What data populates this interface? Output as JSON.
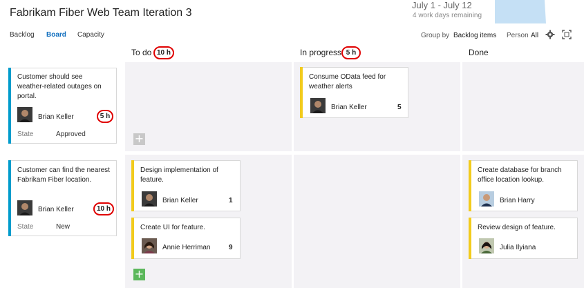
{
  "header": {
    "title": "Fabrikam Fiber Web Team Iteration 3",
    "iteration_dates": "July 1 - July 12",
    "days_remaining": "4 work days remaining"
  },
  "nav": {
    "backlog": "Backlog",
    "board": "Board",
    "capacity": "Capacity"
  },
  "toolbar": {
    "group_by_label": "Group by",
    "group_by_value": "Backlog items",
    "person_label": "Person",
    "person_value": "All",
    "settings_icon": "gear-icon",
    "fullscreen_icon": "fullscreen-icon"
  },
  "columns": [
    {
      "name": "To do",
      "hours": "10 h"
    },
    {
      "name": "In progress",
      "hours": "5 h"
    },
    {
      "name": "Done"
    }
  ],
  "backlog_items": [
    {
      "title_lines": [
        "Customer should see",
        "weather-related outages on",
        "portal."
      ],
      "assignee": "Brian Keller",
      "remaining": "5 h",
      "state_label": "State",
      "state": "Approved"
    },
    {
      "title_lines": [
        "Customer can find the nearest",
        "Fabrikam Fiber location."
      ],
      "assignee": "Brian Keller",
      "remaining": "10 h",
      "state_label": "State",
      "state": "New"
    }
  ],
  "tasks": {
    "row1_inprogress": {
      "title_lines": [
        "Consume OData feed for",
        "weather alerts"
      ],
      "assignee": "Brian Keller",
      "remaining": "5"
    },
    "row2_todo_1": {
      "title_lines": [
        "Design implementation of",
        "feature."
      ],
      "assignee": "Brian Keller",
      "remaining": "1"
    },
    "row2_todo_2": {
      "title_lines": [
        "Create UI for feature."
      ],
      "assignee": "Annie Herriman",
      "remaining": "9"
    },
    "row2_done_1": {
      "title_lines": [
        "Create database for branch",
        "office location lookup."
      ],
      "assignee": "Brian Harry"
    },
    "row2_done_2": {
      "title_lines": [
        "Review design of feature."
      ],
      "assignee": "Julia Ilyiana"
    }
  },
  "add_icon": "+",
  "colors": {
    "accent": "#106ebe",
    "backlog_bar": "#009ccc",
    "task_bar": "#f2cb1d",
    "lane_bg": "#f3f2f5",
    "annotation": "#e00000",
    "add_inactive": "#c8c8c8",
    "add_active": "#5cb85c"
  }
}
